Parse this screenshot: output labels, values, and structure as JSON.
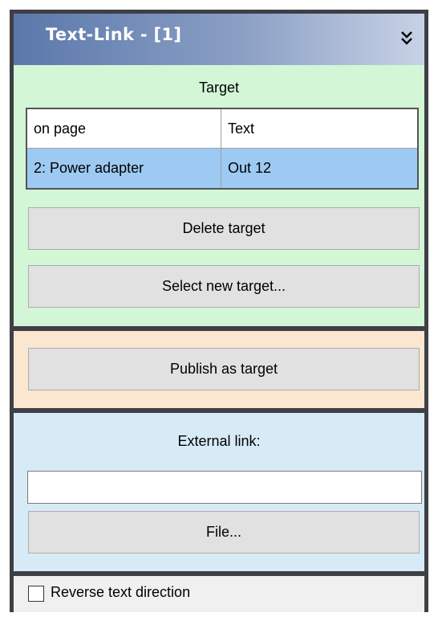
{
  "panel": {
    "title": "Text-Link  -  [1]",
    "collapse_icon": "double-chevron-down-icon"
  },
  "target_section": {
    "label": "Target",
    "table": {
      "columns": [
        "on page",
        "Text"
      ],
      "rows": [
        {
          "page": "2: Power adapter",
          "text": "Out 12",
          "selected": true
        }
      ]
    },
    "delete_button": "Delete target",
    "select_button": "Select new target..."
  },
  "publish_section": {
    "button": "Publish as target"
  },
  "external_section": {
    "label": "External link:",
    "input_value": "",
    "file_button": "File..."
  },
  "options": {
    "reverse_direction_label": "Reverse text direction",
    "reverse_direction_checked": false
  },
  "colors": {
    "target_bg": "#d3f6d6",
    "publish_bg": "#fbe7cf",
    "external_bg": "#d7ebf7",
    "selected_row": "#9dcaf3",
    "titlebar": "#5b78ab"
  }
}
